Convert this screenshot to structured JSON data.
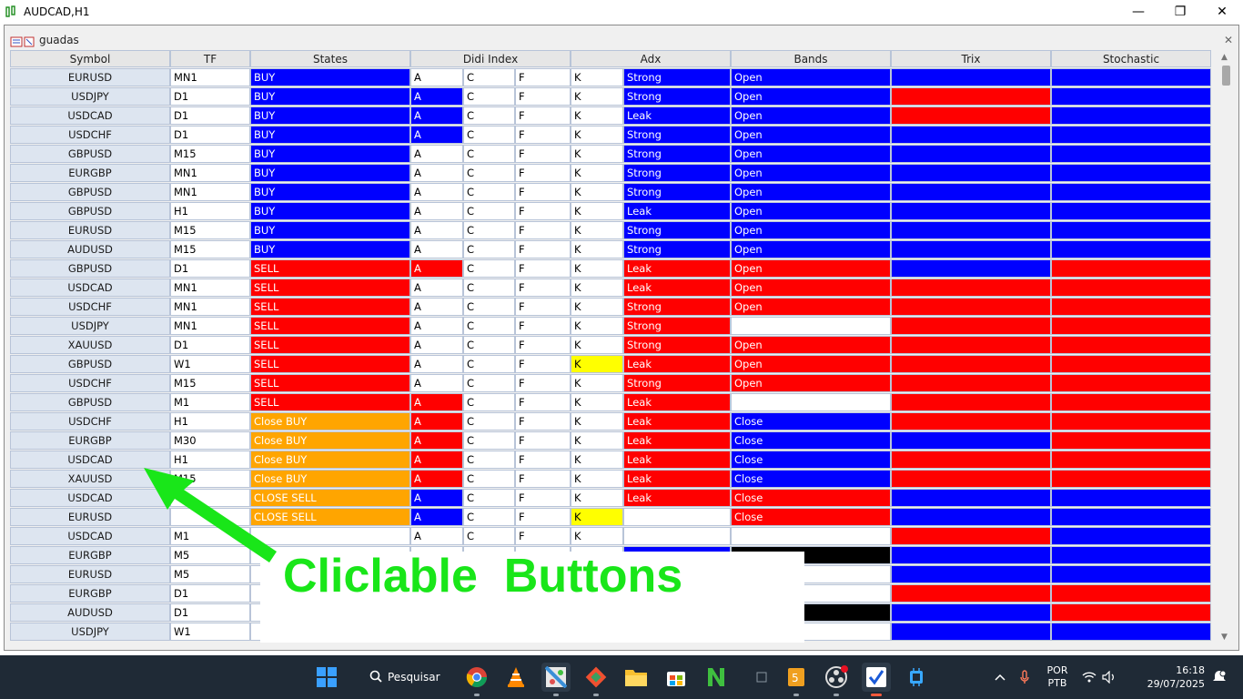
{
  "window": {
    "title": "AUDCAD,H1",
    "minimize": "—",
    "maximize": "❐",
    "close": "✕"
  },
  "panel": {
    "title": "guadas",
    "close": "✕"
  },
  "colors": {
    "blue": "#0000ff",
    "red": "#ff0000",
    "orange": "#ffa500",
    "yellow": "#ffff00",
    "white": "#ffffff",
    "black": "#000000",
    "header_bg": "#e6e6e6",
    "symbol_bg": "#dde5f0",
    "annotation_green": "#19e619"
  },
  "columns": [
    {
      "label": "Symbol"
    },
    {
      "label": "TF"
    },
    {
      "label": "States"
    },
    {
      "label": "Didi Index"
    },
    {
      "label": "Adx"
    },
    {
      "label": "Bands"
    },
    {
      "label": "Trix"
    },
    {
      "label": "Stochastic"
    }
  ],
  "rows": [
    {
      "symbol": "EURUSD",
      "tf": "MN1",
      "state": "BUY",
      "state_bg": "blue",
      "a": "A",
      "a_bg": "white",
      "c": "C",
      "f": "F",
      "k": "K",
      "k_bg": "white",
      "adx": "Strong",
      "adx_bg": "blue",
      "bands": "Open",
      "bands_bg": "blue",
      "trix_bg": "blue",
      "stoch_bg": "blue"
    },
    {
      "symbol": "USDJPY",
      "tf": "D1",
      "state": "BUY",
      "state_bg": "blue",
      "a": "A",
      "a_bg": "blue",
      "c": "C",
      "f": "F",
      "k": "K",
      "k_bg": "white",
      "adx": "Strong",
      "adx_bg": "blue",
      "bands": "Open",
      "bands_bg": "blue",
      "trix_bg": "red",
      "stoch_bg": "blue"
    },
    {
      "symbol": "USDCAD",
      "tf": "D1",
      "state": "BUY",
      "state_bg": "blue",
      "a": "A",
      "a_bg": "blue",
      "c": "C",
      "f": "F",
      "k": "K",
      "k_bg": "white",
      "adx": "Leak",
      "adx_bg": "blue",
      "bands": "Open",
      "bands_bg": "blue",
      "trix_bg": "red",
      "stoch_bg": "blue"
    },
    {
      "symbol": "USDCHF",
      "tf": "D1",
      "state": "BUY",
      "state_bg": "blue",
      "a": "A",
      "a_bg": "blue",
      "c": "C",
      "f": "F",
      "k": "K",
      "k_bg": "white",
      "adx": "Strong",
      "adx_bg": "blue",
      "bands": "Open",
      "bands_bg": "blue",
      "trix_bg": "blue",
      "stoch_bg": "blue"
    },
    {
      "symbol": "GBPUSD",
      "tf": "M15",
      "state": "BUY",
      "state_bg": "blue",
      "a": "A",
      "a_bg": "white",
      "c": "C",
      "f": "F",
      "k": "K",
      "k_bg": "white",
      "adx": "Strong",
      "adx_bg": "blue",
      "bands": "Open",
      "bands_bg": "blue",
      "trix_bg": "blue",
      "stoch_bg": "blue"
    },
    {
      "symbol": "EURGBP",
      "tf": "MN1",
      "state": "BUY",
      "state_bg": "blue",
      "a": "A",
      "a_bg": "white",
      "c": "C",
      "f": "F",
      "k": "K",
      "k_bg": "white",
      "adx": "Strong",
      "adx_bg": "blue",
      "bands": "Open",
      "bands_bg": "blue",
      "trix_bg": "blue",
      "stoch_bg": "blue"
    },
    {
      "symbol": "GBPUSD",
      "tf": "MN1",
      "state": "BUY",
      "state_bg": "blue",
      "a": "A",
      "a_bg": "white",
      "c": "C",
      "f": "F",
      "k": "K",
      "k_bg": "white",
      "adx": "Strong",
      "adx_bg": "blue",
      "bands": "Open",
      "bands_bg": "blue",
      "trix_bg": "blue",
      "stoch_bg": "blue"
    },
    {
      "symbol": "GBPUSD",
      "tf": "H1",
      "state": "BUY",
      "state_bg": "blue",
      "a": "A",
      "a_bg": "white",
      "c": "C",
      "f": "F",
      "k": "K",
      "k_bg": "white",
      "adx": "Leak",
      "adx_bg": "blue",
      "bands": "Open",
      "bands_bg": "blue",
      "trix_bg": "blue",
      "stoch_bg": "blue"
    },
    {
      "symbol": "EURUSD",
      "tf": "M15",
      "state": "BUY",
      "state_bg": "blue",
      "a": "A",
      "a_bg": "white",
      "c": "C",
      "f": "F",
      "k": "K",
      "k_bg": "white",
      "adx": "Strong",
      "adx_bg": "blue",
      "bands": "Open",
      "bands_bg": "blue",
      "trix_bg": "blue",
      "stoch_bg": "blue"
    },
    {
      "symbol": "AUDUSD",
      "tf": "M15",
      "state": "BUY",
      "state_bg": "blue",
      "a": "A",
      "a_bg": "white",
      "c": "C",
      "f": "F",
      "k": "K",
      "k_bg": "white",
      "adx": "Strong",
      "adx_bg": "blue",
      "bands": "Open",
      "bands_bg": "blue",
      "trix_bg": "blue",
      "stoch_bg": "blue"
    },
    {
      "symbol": "GBPUSD",
      "tf": "D1",
      "state": "SELL",
      "state_bg": "red",
      "a": "A",
      "a_bg": "red",
      "c": "C",
      "f": "F",
      "k": "K",
      "k_bg": "white",
      "adx": "Leak",
      "adx_bg": "red",
      "bands": "Open",
      "bands_bg": "red",
      "trix_bg": "blue",
      "stoch_bg": "red"
    },
    {
      "symbol": "USDCAD",
      "tf": "MN1",
      "state": "SELL",
      "state_bg": "red",
      "a": "A",
      "a_bg": "white",
      "c": "C",
      "f": "F",
      "k": "K",
      "k_bg": "white",
      "adx": "Leak",
      "adx_bg": "red",
      "bands": "Open",
      "bands_bg": "red",
      "trix_bg": "red",
      "stoch_bg": "red"
    },
    {
      "symbol": "USDCHF",
      "tf": "MN1",
      "state": "SELL",
      "state_bg": "red",
      "a": "A",
      "a_bg": "white",
      "c": "C",
      "f": "F",
      "k": "K",
      "k_bg": "white",
      "adx": "Strong",
      "adx_bg": "red",
      "bands": "Open",
      "bands_bg": "red",
      "trix_bg": "red",
      "stoch_bg": "red"
    },
    {
      "symbol": "USDJPY",
      "tf": "MN1",
      "state": "SELL",
      "state_bg": "red",
      "a": "A",
      "a_bg": "white",
      "c": "C",
      "f": "F",
      "k": "K",
      "k_bg": "white",
      "adx": "Strong",
      "adx_bg": "red",
      "bands": "",
      "bands_bg": "white",
      "trix_bg": "red",
      "stoch_bg": "red"
    },
    {
      "symbol": "XAUUSD",
      "tf": "D1",
      "state": "SELL",
      "state_bg": "red",
      "a": "A",
      "a_bg": "white",
      "c": "C",
      "f": "F",
      "k": "K",
      "k_bg": "white",
      "adx": "Strong",
      "adx_bg": "red",
      "bands": "Open",
      "bands_bg": "red",
      "trix_bg": "red",
      "stoch_bg": "red"
    },
    {
      "symbol": "GBPUSD",
      "tf": "W1",
      "state": "SELL",
      "state_bg": "red",
      "a": "A",
      "a_bg": "white",
      "c": "C",
      "f": "F",
      "k": "K",
      "k_bg": "yellow",
      "adx": "Leak",
      "adx_bg": "red",
      "bands": "Open",
      "bands_bg": "red",
      "trix_bg": "red",
      "stoch_bg": "red"
    },
    {
      "symbol": "USDCHF",
      "tf": "M15",
      "state": "SELL",
      "state_bg": "red",
      "a": "A",
      "a_bg": "white",
      "c": "C",
      "f": "F",
      "k": "K",
      "k_bg": "white",
      "adx": "Strong",
      "adx_bg": "red",
      "bands": "Open",
      "bands_bg": "red",
      "trix_bg": "red",
      "stoch_bg": "red"
    },
    {
      "symbol": "GBPUSD",
      "tf": "M1",
      "state": "SELL",
      "state_bg": "red",
      "a": "A",
      "a_bg": "red",
      "c": "C",
      "f": "F",
      "k": "K",
      "k_bg": "white",
      "adx": "Leak",
      "adx_bg": "red",
      "bands": "",
      "bands_bg": "white",
      "trix_bg": "red",
      "stoch_bg": "red"
    },
    {
      "symbol": "USDCHF",
      "tf": "H1",
      "state": "Close BUY",
      "state_bg": "orange",
      "a": "A",
      "a_bg": "red",
      "c": "C",
      "f": "F",
      "k": "K",
      "k_bg": "white",
      "adx": "Leak",
      "adx_bg": "red",
      "bands": "Close",
      "bands_bg": "blue",
      "trix_bg": "red",
      "stoch_bg": "red"
    },
    {
      "symbol": "EURGBP",
      "tf": "M30",
      "state": "Close BUY",
      "state_bg": "orange",
      "a": "A",
      "a_bg": "red",
      "c": "C",
      "f": "F",
      "k": "K",
      "k_bg": "white",
      "adx": "Leak",
      "adx_bg": "red",
      "bands": "Close",
      "bands_bg": "blue",
      "trix_bg": "blue",
      "stoch_bg": "red"
    },
    {
      "symbol": "USDCAD",
      "tf": "H1",
      "state": "Close BUY",
      "state_bg": "orange",
      "a": "A",
      "a_bg": "red",
      "c": "C",
      "f": "F",
      "k": "K",
      "k_bg": "white",
      "adx": "Leak",
      "adx_bg": "red",
      "bands": "Close",
      "bands_bg": "blue",
      "trix_bg": "red",
      "stoch_bg": "red"
    },
    {
      "symbol": "XAUUSD",
      "tf": "M15",
      "state": "Close BUY",
      "state_bg": "orange",
      "a": "A",
      "a_bg": "red",
      "c": "C",
      "f": "F",
      "k": "K",
      "k_bg": "white",
      "adx": "Leak",
      "adx_bg": "red",
      "bands": "Close",
      "bands_bg": "blue",
      "trix_bg": "red",
      "stoch_bg": "red"
    },
    {
      "symbol": "USDCAD",
      "tf": "",
      "state": "CLOSE SELL",
      "state_bg": "orange",
      "a": "A",
      "a_bg": "blue",
      "c": "C",
      "f": "F",
      "k": "K",
      "k_bg": "white",
      "adx": "Leak",
      "adx_bg": "red",
      "bands": "Close",
      "bands_bg": "red",
      "trix_bg": "blue",
      "stoch_bg": "blue"
    },
    {
      "symbol": "EURUSD",
      "tf": "",
      "state": "CLOSE SELL",
      "state_bg": "orange",
      "a": "A",
      "a_bg": "blue",
      "c": "C",
      "f": "F",
      "k": "K",
      "k_bg": "yellow",
      "adx": "",
      "adx_bg": "white",
      "bands": "Close",
      "bands_bg": "red",
      "trix_bg": "blue",
      "stoch_bg": "blue"
    },
    {
      "symbol": "USDCAD",
      "tf": "M1",
      "state": "",
      "state_bg": "white",
      "a": "A",
      "a_bg": "white",
      "c": "C",
      "f": "F",
      "k": "K",
      "k_bg": "white",
      "adx": "",
      "adx_bg": "white",
      "bands": "",
      "bands_bg": "white",
      "trix_bg": "red",
      "stoch_bg": "blue"
    },
    {
      "symbol": "EURGBP",
      "tf": "M5",
      "state": "",
      "state_bg": "white",
      "a": "",
      "a_bg": "white",
      "c": "",
      "f": "",
      "k": "",
      "k_bg": "white",
      "adx": "",
      "adx_bg": "blue",
      "bands": "",
      "bands_bg": "black",
      "trix_bg": "blue",
      "stoch_bg": "blue"
    },
    {
      "symbol": "EURUSD",
      "tf": "M5",
      "state": "",
      "state_bg": "white",
      "a": "",
      "a_bg": "white",
      "c": "",
      "f": "",
      "k": "",
      "k_bg": "white",
      "adx": "",
      "adx_bg": "white",
      "bands": "",
      "bands_bg": "white",
      "trix_bg": "blue",
      "stoch_bg": "blue"
    },
    {
      "symbol": "EURGBP",
      "tf": "D1",
      "state": "",
      "state_bg": "white",
      "a": "",
      "a_bg": "white",
      "c": "",
      "f": "",
      "k": "",
      "k_bg": "white",
      "adx": "",
      "adx_bg": "white",
      "bands": "",
      "bands_bg": "white",
      "trix_bg": "red",
      "stoch_bg": "red"
    },
    {
      "symbol": "AUDUSD",
      "tf": "D1",
      "state": "",
      "state_bg": "white",
      "a": "",
      "a_bg": "white",
      "c": "",
      "f": "",
      "k": "",
      "k_bg": "white",
      "adx": "",
      "adx_bg": "white",
      "bands": "",
      "bands_bg": "black",
      "trix_bg": "blue",
      "stoch_bg": "red"
    },
    {
      "symbol": "USDJPY",
      "tf": "W1",
      "state": "",
      "state_bg": "white",
      "a": "",
      "a_bg": "blue",
      "c": "",
      "f": "",
      "k": "",
      "k_bg": "white",
      "adx": "",
      "adx_bg": "white",
      "bands": "",
      "bands_bg": "white",
      "trix_bg": "blue",
      "stoch_bg": "blue"
    }
  ],
  "annotation": {
    "text": "Cliclable  Buttons"
  },
  "taskbar": {
    "search_label": "Pesquisar",
    "apps": [
      {
        "name": "windows-start-icon"
      },
      {
        "name": "chrome-icon"
      },
      {
        "name": "vlc-icon"
      },
      {
        "name": "paint-icon"
      },
      {
        "name": "git-icon"
      },
      {
        "name": "file-explorer-icon"
      },
      {
        "name": "store-icon"
      },
      {
        "name": "notepad-plus-icon"
      },
      {
        "name": "app-small-icon"
      },
      {
        "name": "sublime-icon"
      },
      {
        "name": "obs-icon"
      },
      {
        "name": "metatrader-icon"
      },
      {
        "name": "chip-icon"
      }
    ],
    "lang_top": "POR",
    "lang_bottom": "PTB",
    "time": "16:18",
    "date": "29/07/2025"
  }
}
